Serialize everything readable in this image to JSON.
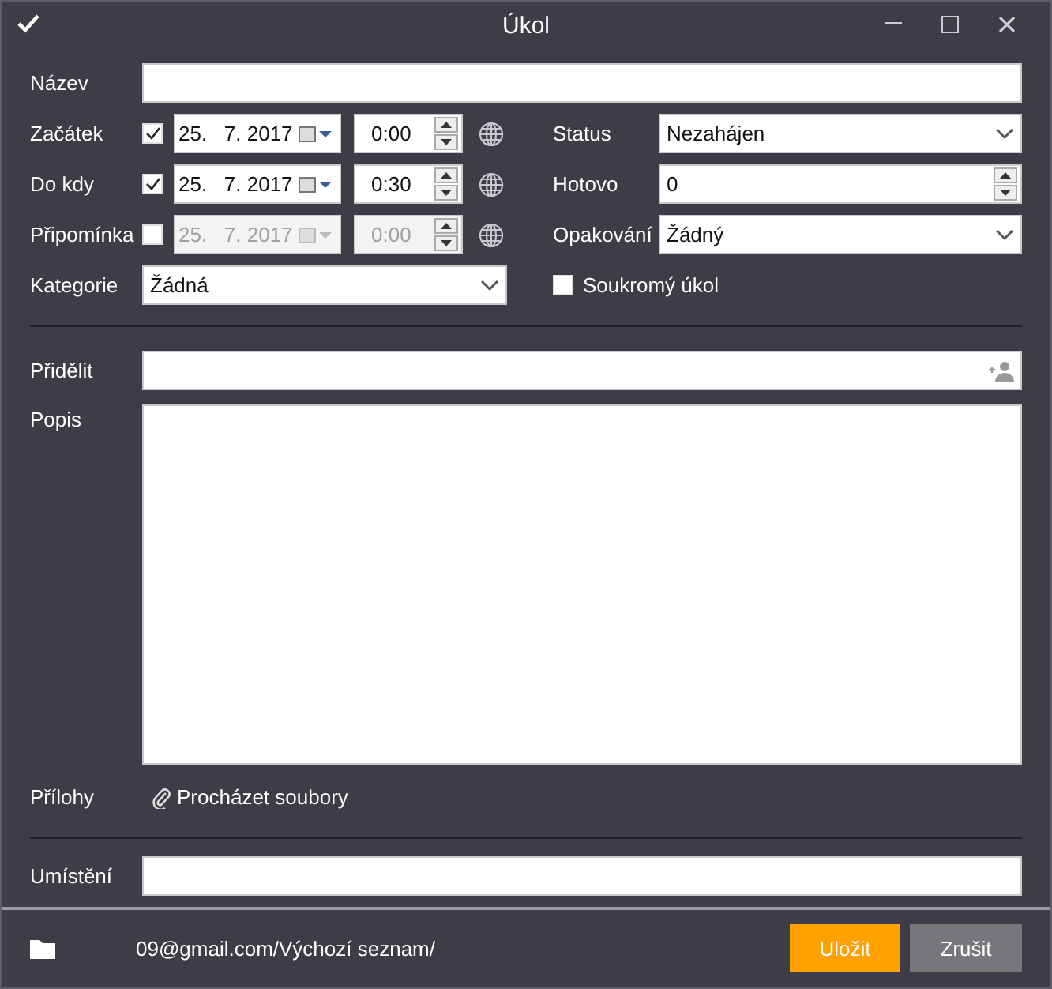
{
  "window": {
    "title": "Úkol"
  },
  "name": {
    "label": "Název"
  },
  "schedule": [
    {
      "label": "Začátek",
      "checked": true,
      "date": "25.   7. 2017",
      "time": "0:00",
      "disabled": false
    },
    {
      "label": "Do kdy",
      "checked": true,
      "date": "25.   7. 2017",
      "time": "0:30",
      "disabled": false
    },
    {
      "label": "Připomínka",
      "checked": false,
      "date": "25.   7. 2017",
      "time": "0:00",
      "disabled": true
    }
  ],
  "right_fields": [
    {
      "kind": "select",
      "label": "Status",
      "value": "Nezahájen"
    },
    {
      "kind": "spin",
      "label": "Hotovo",
      "value": "0"
    },
    {
      "kind": "select",
      "label": "Opakování",
      "value": "Žádný"
    }
  ],
  "category": {
    "label": "Kategorie",
    "value": "Žádná"
  },
  "private_task": {
    "label": "Soukromý úkol",
    "checked": false
  },
  "assign": {
    "label": "Přidělit"
  },
  "description": {
    "label": "Popis"
  },
  "attachments": {
    "label": "Přílohy",
    "link": "Procházet soubory"
  },
  "location": {
    "label": "Umístění"
  },
  "footer": {
    "path": "09@gmail.com/Výchozí seznam/",
    "buttons": [
      {
        "label": "Uložit",
        "kind": "primary"
      },
      {
        "label": "Zrušit",
        "kind": "secondary"
      }
    ]
  }
}
